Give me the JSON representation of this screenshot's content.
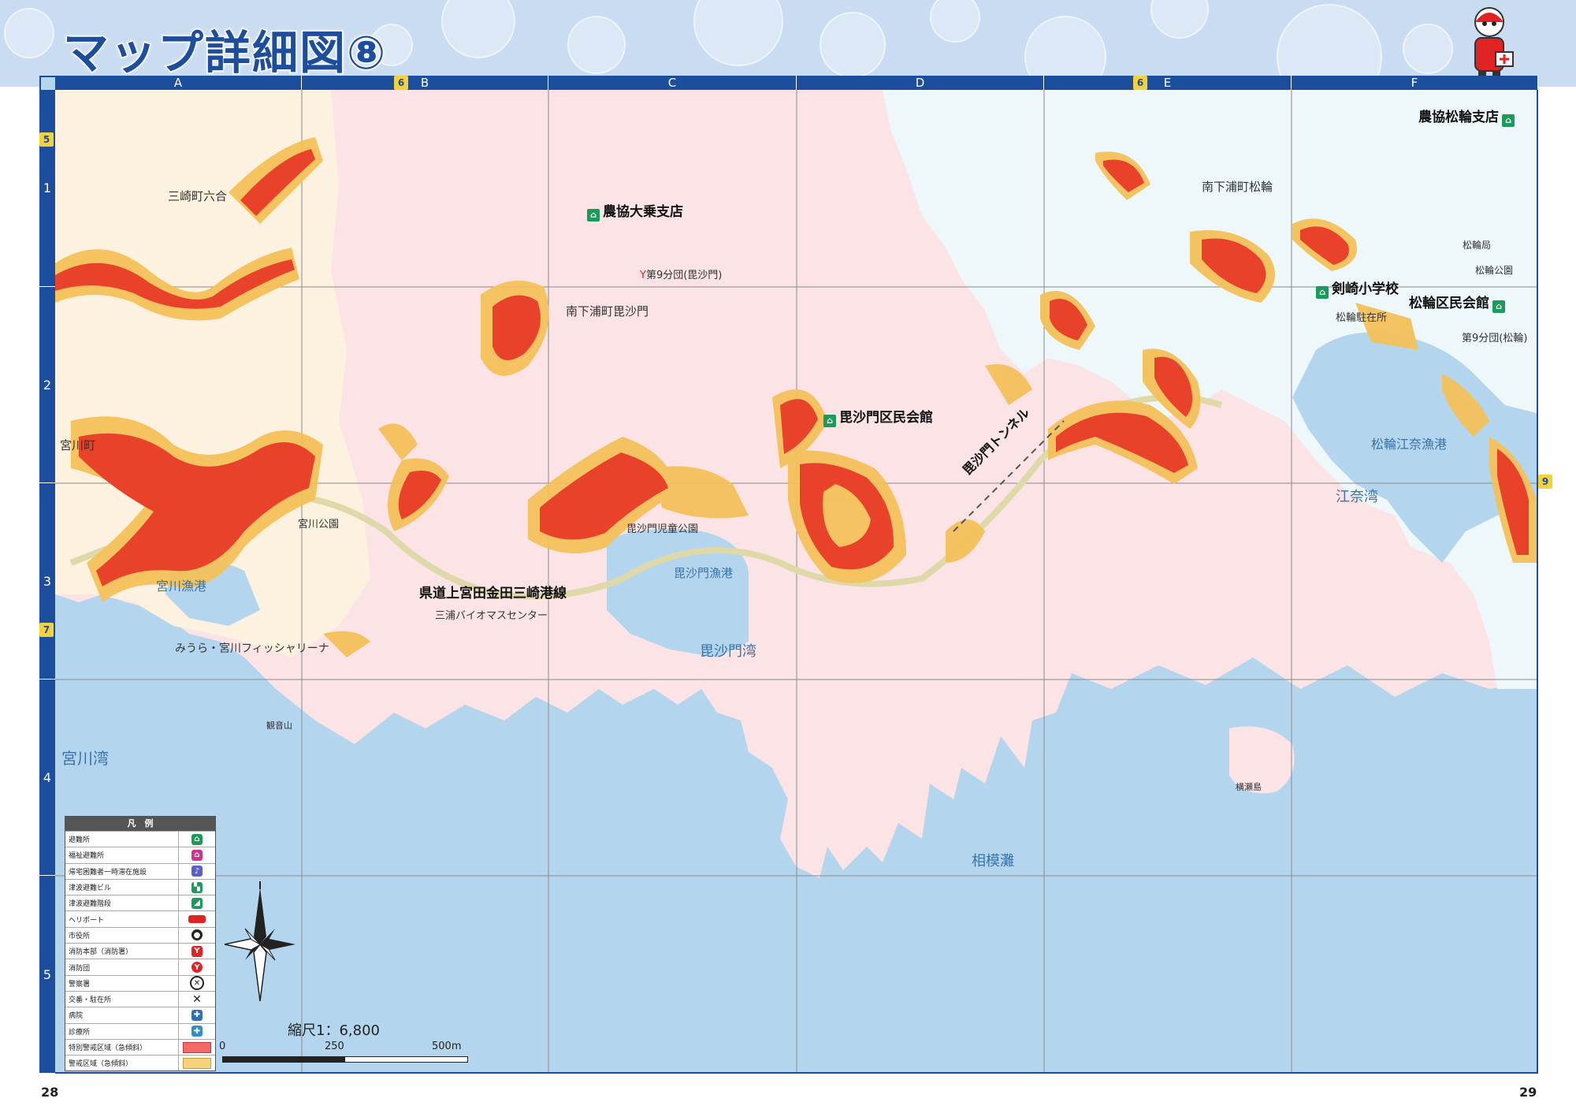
{
  "title": "マップ詳細図⑧",
  "page_left": "28",
  "page_right": "29",
  "columns": [
    "A",
    "B",
    "C",
    "D",
    "E",
    "F"
  ],
  "rows": [
    "1",
    "2",
    "3",
    "4",
    "5"
  ],
  "adjacent_markers": {
    "top_b": "6",
    "top_e": "6",
    "left_top": "5",
    "left_bottom": "7",
    "right": "9"
  },
  "places": {
    "nokyo_ojo": "農協大乗支店",
    "nokyo_matsuwa": "農協松輪支店",
    "bishamon_kaikan": "毘沙門区民会館",
    "kenzaki_school": "剣崎小学校",
    "matsuwa_kaikan": "松輪区民会館",
    "fire_9_bishamon": "第9分団(毘沙門)",
    "fire_9_matsuwa": "第9分団(松輪)",
    "matsuwa_police": "松輪駐在所",
    "matsuwa_kyoku": "松輪局",
    "matsuwa_park": "松輪公園",
    "minami_bishamon": "南下浦町毘沙門",
    "minami_matsuwa": "南下浦町松輪",
    "misaki_mutsuai": "三崎町六合",
    "miyagawa_cho": "宮川町",
    "miyagawa_park": "宮川公園",
    "miyagawa_port": "宮川漁港",
    "miyagawa_arena": "みうら・宮川フィッシャリーナ",
    "kannonyama": "観音山",
    "miyagawa_bay": "宮川湾",
    "bishamon_park": "毘沙門児童公園",
    "bishamon_port": "毘沙門漁港",
    "bishamon_bay": "毘沙門湾",
    "bishamon_tunnel": "毘沙門トンネル",
    "pref_road": "県道上宮田金田三崎港線",
    "bio_mass": "三浦バイオマスセンター",
    "matsuwa_enaport": "松輪江奈漁港",
    "ena_bay": "江奈湾",
    "sagami_nada": "相模灘",
    "yokosu_island": "横瀬島"
  },
  "legend": {
    "header": "凡　例",
    "items": [
      {
        "label": "避難所",
        "icon": "shelter-icon",
        "color": "#1c9a5b"
      },
      {
        "label": "福祉避難所",
        "icon": "welfare-shelter-icon",
        "color": "#d0338f"
      },
      {
        "label": "帰宅困難者一時滞在施設",
        "icon": "temporary-stay-icon",
        "color": "#5b5fc7"
      },
      {
        "label": "津波避難ビル",
        "icon": "tsunami-building-icon",
        "color": "#1c9a5b"
      },
      {
        "label": "津波避難階段",
        "icon": "tsunami-stairs-icon",
        "color": "#1c9a5b"
      },
      {
        "label": "ヘリポート",
        "icon": "heliport-icon",
        "color": "#e02424"
      },
      {
        "label": "市役所",
        "icon": "city-hall-icon",
        "color": "#222222"
      },
      {
        "label": "消防本部（消防署）",
        "icon": "fire-hq-icon",
        "color": "#e02424"
      },
      {
        "label": "消防団",
        "icon": "fire-brigade-icon",
        "color": "#e02424"
      },
      {
        "label": "警察署",
        "icon": "police-station-icon",
        "color": "#222222"
      },
      {
        "label": "交番・駐在所",
        "icon": "police-box-icon",
        "color": "#222222"
      },
      {
        "label": "病院",
        "icon": "hospital-icon",
        "color": "#2e6fb6"
      },
      {
        "label": "診療所",
        "icon": "clinic-icon",
        "color": "#2e8fc7"
      },
      {
        "label": "特別警戒区域（急傾斜）",
        "icon": "special-warning-swatch",
        "color": "#f06a6a"
      },
      {
        "label": "警戒区域（急傾斜）",
        "icon": "warning-swatch",
        "color": "#f6d27a"
      }
    ]
  },
  "scale": {
    "label": "縮尺1：6,800",
    "ticks": [
      "0",
      "250",
      "500m"
    ]
  },
  "colors": {
    "sea": "#b3d6ee",
    "land_pink": "#fbe3e6",
    "land_yellow": "#fdf2df",
    "land_cyan": "#eef7f9",
    "special_zone": "#e8432a",
    "warning_zone": "#f4c15a",
    "frame": "#1d4e9e"
  }
}
